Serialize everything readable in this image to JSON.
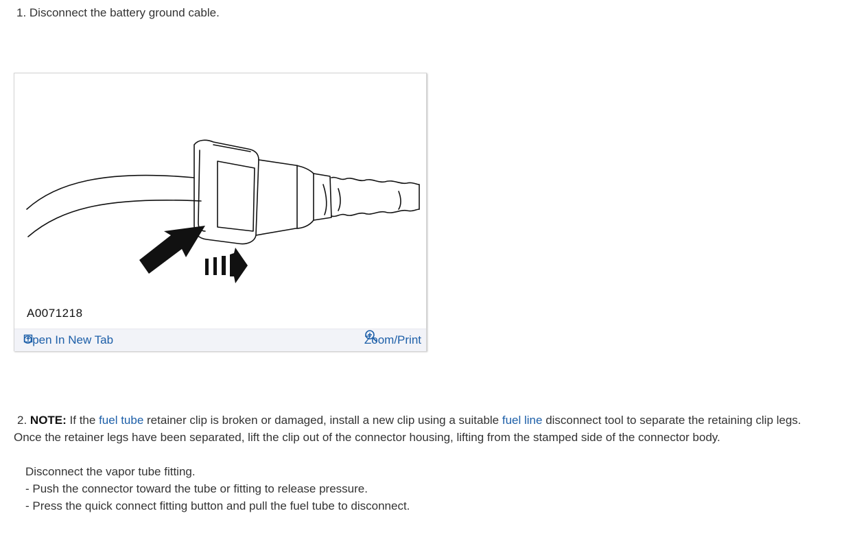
{
  "step1": {
    "text": "1. Disconnect the battery ground cable."
  },
  "figure": {
    "id": "A0071218",
    "open_tab_label": "Open In New Tab",
    "zoom_label": "Zoom/Print",
    "open_tab_icon": "open-new-tab-icon",
    "zoom_icon": "zoom-in-icon"
  },
  "step2": {
    "number": "2.",
    "note_label": "NOTE:",
    "t1": " If the ",
    "link1": "fuel tube",
    "t2": " retainer clip is broken or damaged, install a new clip using a suitable ",
    "link2": "fuel line",
    "t3": " disconnect tool to separate the retaining clip legs.",
    "line2": "Once the retainer legs have been separated, lift the clip out of the connector housing, lifting from the stamped side of the connector body."
  },
  "substeps": {
    "intro": "Disconnect the vapor tube fitting.",
    "items": [
      "-  Push the connector toward the tube or fitting to release pressure.",
      "-  Press the quick connect fitting button and pull the fuel tube to disconnect."
    ]
  },
  "colors": {
    "link": "#1d5fa8",
    "text": "#333333",
    "bar": "#f2f3f8"
  }
}
